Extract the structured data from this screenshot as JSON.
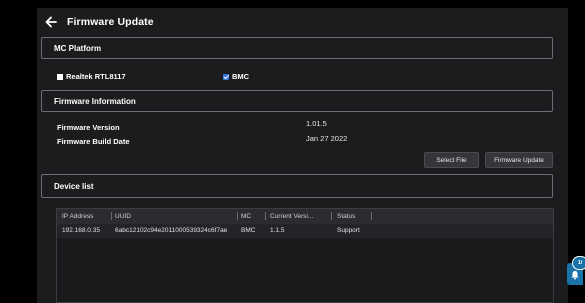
{
  "header": {
    "title": "Firmware Update",
    "back_icon": "arrow-left-icon"
  },
  "sections": {
    "platform": "MC Platform",
    "info": "Firmware Information",
    "devices": "Device list"
  },
  "platform_options": [
    {
      "label": "Realtek RTL8117",
      "checked": false
    },
    {
      "label": "BMC",
      "checked": true
    }
  ],
  "firmware": {
    "version_label": "Firmware Version",
    "version_value": "1.01.5",
    "build_date_label": "Firmware Build Date",
    "build_date_value": "Jan 27 2022"
  },
  "buttons": {
    "select_file": "Select File",
    "firmware_update": "Firmware Update"
  },
  "table": {
    "headers": [
      "IP Address",
      "UUID",
      "MC",
      "Current Versi...",
      "Status"
    ],
    "rows": [
      {
        "ip": "192.168.0.35",
        "uuid": "6abc12102c94e2011000539324c6f7ae",
        "mc": "BMC",
        "version": "1.1.5",
        "status": "Support"
      }
    ]
  },
  "notification": {
    "badge": "1/",
    "icon": "bell-icon",
    "accent": "#1a73a8"
  }
}
